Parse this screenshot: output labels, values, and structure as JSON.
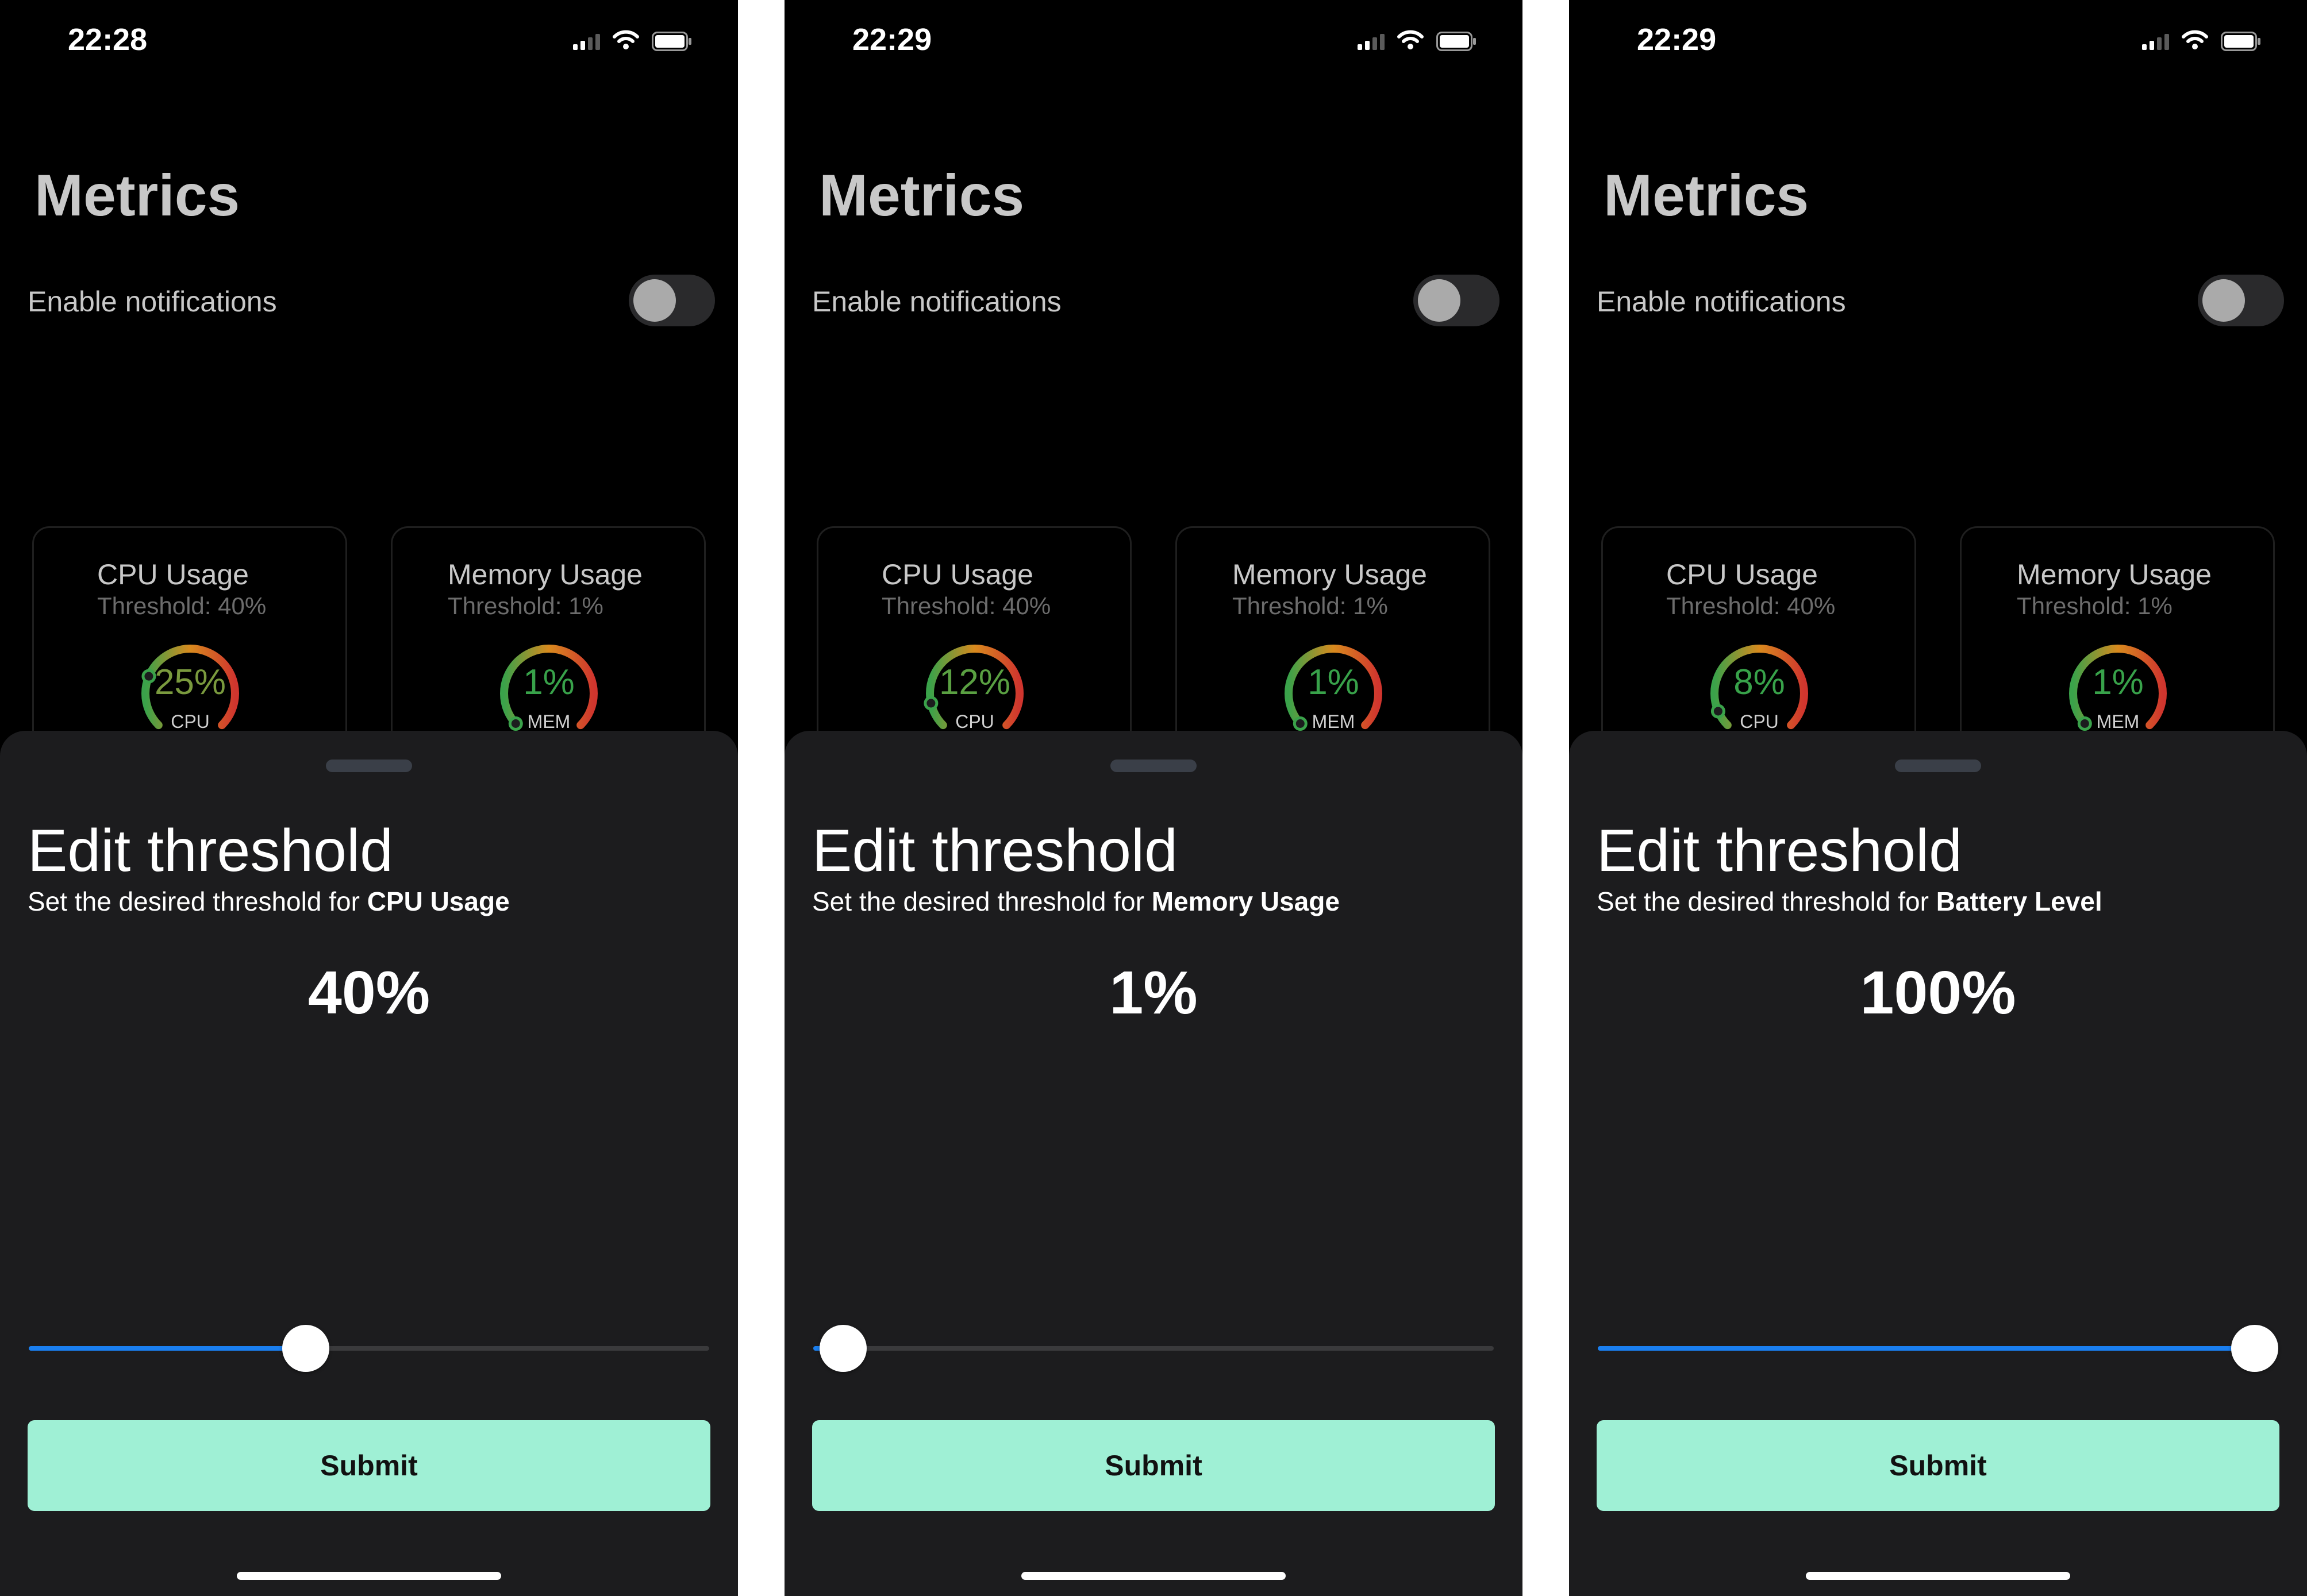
{
  "screens": [
    {
      "time": "22:28",
      "title": "Metrics",
      "notifications": {
        "label": "Enable notifications",
        "enabled": false
      },
      "cards": [
        {
          "title": "CPU Usage",
          "threshold": "Threshold: 40%",
          "value": "25%",
          "gauge_label": "CPU",
          "value_color": "#7a9a3e",
          "level": 0.25
        },
        {
          "title": "Memory Usage",
          "threshold": "Threshold: 1%",
          "value": "1%",
          "gauge_label": "MEM",
          "value_color": "#38a24a",
          "level": 0.01
        }
      ],
      "sheet": {
        "title": "Edit threshold",
        "subtitle_prefix": "Set the desired threshold for ",
        "metric_name": "CPU Usage",
        "value": "40%",
        "slider_value": 0.4,
        "submit_label": "Submit"
      }
    },
    {
      "time": "22:29",
      "title": "Metrics",
      "notifications": {
        "label": "Enable notifications",
        "enabled": false
      },
      "cards": [
        {
          "title": "CPU Usage",
          "threshold": "Threshold: 40%",
          "value": "12%",
          "gauge_label": "CPU",
          "value_color": "#5aa042",
          "level": 0.12
        },
        {
          "title": "Memory Usage",
          "threshold": "Threshold: 1%",
          "value": "1%",
          "gauge_label": "MEM",
          "value_color": "#38a24a",
          "level": 0.01
        }
      ],
      "sheet": {
        "title": "Edit threshold",
        "subtitle_prefix": "Set the desired threshold for ",
        "metric_name": "Memory Usage",
        "value": "1%",
        "slider_value": 0.01,
        "submit_label": "Submit"
      }
    },
    {
      "time": "22:29",
      "title": "Metrics",
      "notifications": {
        "label": "Enable notifications",
        "enabled": false
      },
      "cards": [
        {
          "title": "CPU Usage",
          "threshold": "Threshold: 40%",
          "value": "8%",
          "gauge_label": "CPU",
          "value_color": "#38a24a",
          "level": 0.08
        },
        {
          "title": "Memory Usage",
          "threshold": "Threshold: 1%",
          "value": "1%",
          "gauge_label": "MEM",
          "value_color": "#38a24a",
          "level": 0.01
        }
      ],
      "sheet": {
        "title": "Edit threshold",
        "subtitle_prefix": "Set the desired threshold for ",
        "metric_name": "Battery Level",
        "value": "100%",
        "slider_value": 1.0,
        "submit_label": "Submit"
      }
    }
  ],
  "colors": {
    "slider_fill": "#1a7ff0",
    "submit_bg": "#9ff0d5",
    "sheet_bg": "#1c1c1e",
    "gauge_start": "#3aa24a",
    "gauge_mid": "#d88a1e",
    "gauge_end": "#d0352e"
  },
  "icons": [
    "cellular-signal-icon",
    "wifi-icon",
    "battery-icon"
  ]
}
